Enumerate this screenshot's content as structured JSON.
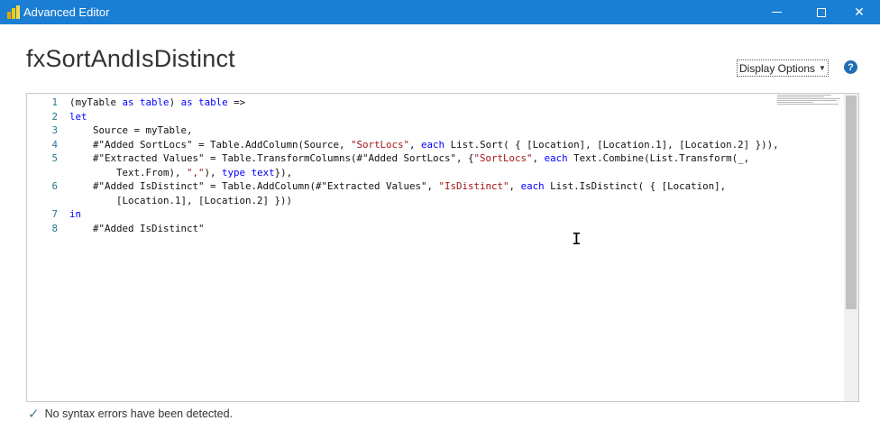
{
  "window": {
    "title": "Advanced Editor",
    "buttons": {
      "minimize": "minimize",
      "maximize": "maximize",
      "close": "✕"
    }
  },
  "query": {
    "name": "fxSortAndIsDistinct"
  },
  "toolbar": {
    "display_options_label": "Display Options",
    "help_label": "?"
  },
  "editor": {
    "lines": [
      {
        "num": "1",
        "tokens": [
          {
            "t": "(myTable ",
            "c": ""
          },
          {
            "t": "as",
            "c": "kw"
          },
          {
            "t": " ",
            "c": ""
          },
          {
            "t": "table",
            "c": "kw"
          },
          {
            "t": ") ",
            "c": ""
          },
          {
            "t": "as",
            "c": "kw"
          },
          {
            "t": " ",
            "c": ""
          },
          {
            "t": "table",
            "c": "kw"
          },
          {
            "t": " =>",
            "c": ""
          }
        ]
      },
      {
        "num": "2",
        "tokens": [
          {
            "t": "let",
            "c": "kw"
          }
        ]
      },
      {
        "num": "3",
        "tokens": [
          {
            "t": "    Source = myTable,",
            "c": ""
          }
        ]
      },
      {
        "num": "4",
        "tokens": [
          {
            "t": "    #\"Added SortLocs\" = Table.AddColumn(Source, ",
            "c": ""
          },
          {
            "t": "\"SortLocs\"",
            "c": "str"
          },
          {
            "t": ", ",
            "c": ""
          },
          {
            "t": "each",
            "c": "kw"
          },
          {
            "t": " List.Sort( { [Location], [Location.1], [Location.2] })),",
            "c": ""
          }
        ]
      },
      {
        "num": "5",
        "tokens": [
          {
            "t": "    #\"Extracted Values\" = Table.TransformColumns(#\"Added SortLocs\", {",
            "c": ""
          },
          {
            "t": "\"SortLocs\"",
            "c": "str"
          },
          {
            "t": ", ",
            "c": ""
          },
          {
            "t": "each",
            "c": "kw"
          },
          {
            "t": " Text.Combine(List.Transform(_,",
            "c": ""
          }
        ]
      },
      {
        "num": "",
        "tokens": [
          {
            "t": "        Text.From), ",
            "c": ""
          },
          {
            "t": "\",\"",
            "c": "str"
          },
          {
            "t": "), ",
            "c": ""
          },
          {
            "t": "type",
            "c": "kw"
          },
          {
            "t": " ",
            "c": ""
          },
          {
            "t": "text",
            "c": "kw"
          },
          {
            "t": "}),",
            "c": ""
          }
        ]
      },
      {
        "num": "6",
        "tokens": [
          {
            "t": "    #\"Added IsDistinct\" = Table.AddColumn(#\"Extracted Values\", ",
            "c": ""
          },
          {
            "t": "\"IsDistinct\"",
            "c": "str"
          },
          {
            "t": ", ",
            "c": ""
          },
          {
            "t": "each",
            "c": "kw"
          },
          {
            "t": " List.IsDistinct( { [Location],",
            "c": ""
          }
        ]
      },
      {
        "num": "",
        "tokens": [
          {
            "t": "        [Location.1], [Location.2] }))",
            "c": ""
          }
        ]
      },
      {
        "num": "7",
        "tokens": [
          {
            "t": "in",
            "c": "kw"
          }
        ]
      },
      {
        "num": "8",
        "tokens": [
          {
            "t": "    #\"Added IsDistinct\"",
            "c": ""
          }
        ]
      }
    ]
  },
  "status": {
    "message": "No syntax errors have been detected."
  },
  "icons": {
    "app": "powerbi-icon",
    "help": "help-icon",
    "check": "checkmark-icon",
    "caret": "chevron-down-icon"
  },
  "colors": {
    "titlebar": "#1a7ed4",
    "keyword": "#0000ff",
    "string": "#a31515",
    "line_number": "#237893"
  }
}
